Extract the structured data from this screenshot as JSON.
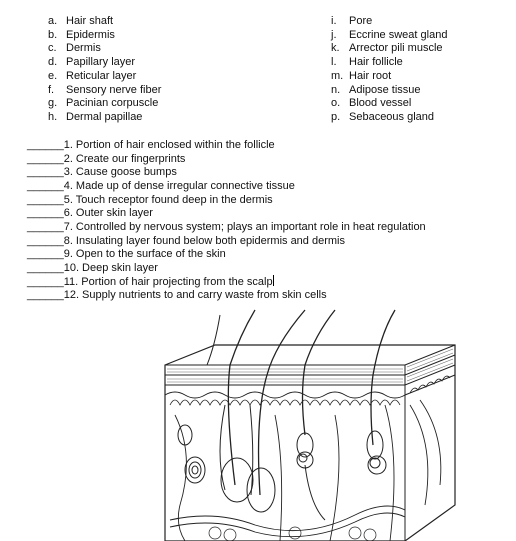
{
  "terms_left": [
    {
      "letter": "a.",
      "label": "Hair shaft"
    },
    {
      "letter": "b.",
      "label": "Epidermis"
    },
    {
      "letter": "c.",
      "label": "Dermis"
    },
    {
      "letter": "d.",
      "label": "Papillary layer"
    },
    {
      "letter": "e.",
      "label": "Reticular layer"
    },
    {
      "letter": "f.",
      "label": "Sensory nerve fiber"
    },
    {
      "letter": "g.",
      "label": "Pacinian corpuscle"
    },
    {
      "letter": "h.",
      "label": "Dermal papillae"
    }
  ],
  "terms_right": [
    {
      "letter": "i.",
      "label": "Pore"
    },
    {
      "letter": "j.",
      "label": "Eccrine sweat gland"
    },
    {
      "letter": "k.",
      "label": "Arrector pili muscle"
    },
    {
      "letter": "l.",
      "label": "Hair follicle"
    },
    {
      "letter": "m.",
      "label": "Hair root"
    },
    {
      "letter": "n.",
      "label": "Adipose tissue"
    },
    {
      "letter": "o.",
      "label": "Blood vessel"
    },
    {
      "letter": "p.",
      "label": "Sebaceous gland"
    }
  ],
  "questions": [
    {
      "text": "______1.  Portion of hair enclosed within the follicle"
    },
    {
      "text": "______2.  Create our fingerprints"
    },
    {
      "text": "______3.  Cause goose bumps"
    },
    {
      "text": "______4.  Made up of dense irregular connective tissue"
    },
    {
      "text": "______5.  Touch receptor found deep in the dermis"
    },
    {
      "text": "______6.  Outer skin layer"
    },
    {
      "text": "______7.  Controlled by nervous system; plays an important role in heat regulation"
    },
    {
      "text": "______8.  Insulating layer found below both epidermis and dermis"
    },
    {
      "text": "______9.  Open to the surface of the skin"
    },
    {
      "text": "______10.  Deep skin layer"
    },
    {
      "text": "______11.  Portion of hair projecting from the scalp"
    },
    {
      "text": "______12.  Supply nutrients to and carry waste from skin cells"
    }
  ],
  "diagram": {
    "icon": "skin-cross-section-diagram"
  }
}
